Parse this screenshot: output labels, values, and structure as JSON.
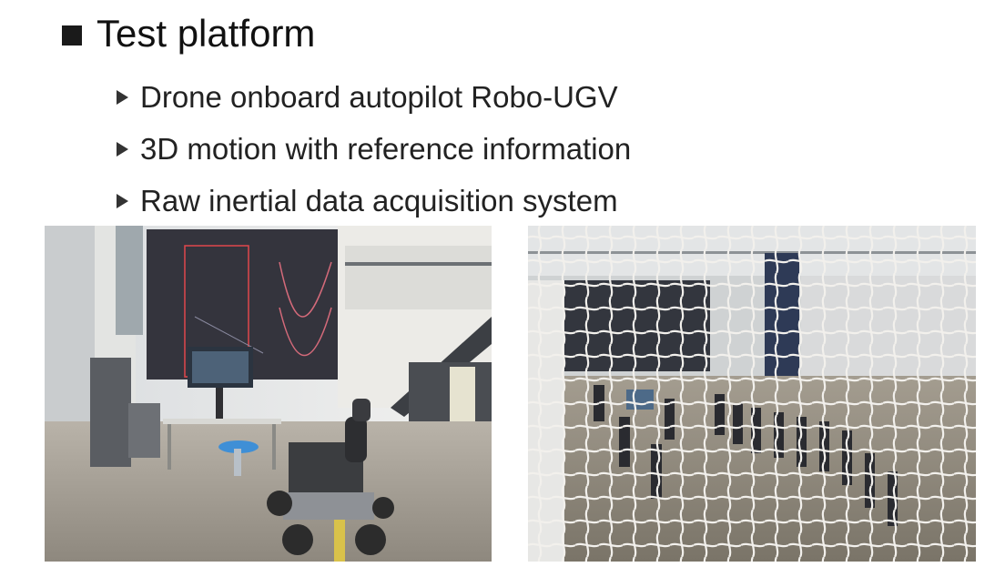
{
  "slide": {
    "title": "Test platform",
    "bullets": [
      "Drone onboard autopilot Robo-UGV",
      "3D motion with reference information",
      "Raw inertial data acquisition system"
    ]
  },
  "photos": {
    "left": {
      "subject": "indoor lab with large display wall, control desk and wheeled robot with manipulator arm"
    },
    "right": {
      "subject": "view through safety net of flight test arena with group of people below"
    }
  },
  "colors": {
    "title_bullet": "#1a1a1a",
    "bullet_marker": "#333333",
    "display_wall": "#3a3a44",
    "signal_red": "#e0474c"
  }
}
